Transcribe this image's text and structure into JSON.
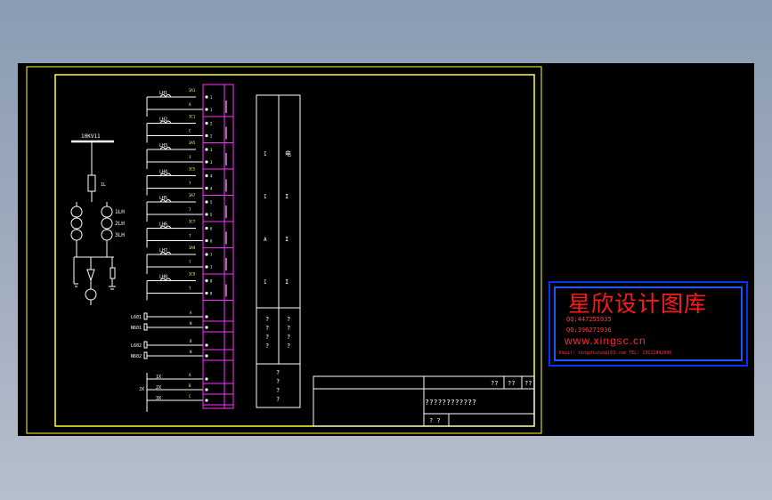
{
  "colors": {
    "frame": "#ffff33",
    "line": "#ffffff",
    "terminal": "#ff33ff",
    "wire_label": "#ffff66",
    "brand_red": "#ff1a1a",
    "brand_blue": "#0033ff"
  },
  "busbar_label": "10KV11",
  "transformer_label": "1L",
  "ct_labels": [
    "1LH",
    "2LH",
    "3LH"
  ],
  "relays": [
    {
      "name": "LH1",
      "wires": [
        "3A1",
        "A"
      ]
    },
    {
      "name": "LH2",
      "wires": [
        "3C1",
        "C"
      ]
    },
    {
      "name": "LH3",
      "wires": [
        "3A5",
        "3"
      ]
    },
    {
      "name": "LH4",
      "wires": [
        "3C5",
        "7"
      ]
    },
    {
      "name": "LH5",
      "wires": [
        "3A7",
        "7"
      ]
    },
    {
      "name": "LH6",
      "wires": [
        "3C7",
        "7"
      ]
    },
    {
      "name": "LH7",
      "wires": [
        "3A9",
        "7"
      ]
    },
    {
      "name": "LH8",
      "wires": [
        "3C9",
        "7"
      ]
    }
  ],
  "signals": [
    {
      "name": "L601",
      "wire": "A"
    },
    {
      "name": "N601",
      "wire": "N"
    },
    {
      "name": "L602",
      "wire": "B"
    },
    {
      "name": "N602",
      "wire": "N"
    }
  ],
  "bottom_group": {
    "prefix": "JX",
    "rows": [
      {
        "name": "1X",
        "wire": "A"
      },
      {
        "name": "2X",
        "wire": "B"
      },
      {
        "name": "3X",
        "wire": "C"
      }
    ]
  },
  "legend_table": {
    "col1": [
      "I",
      "I",
      "A",
      "I"
    ],
    "col2": [
      "电",
      "I",
      "I",
      "I"
    ],
    "notes_col1": [
      "?",
      "?",
      "?",
      "?"
    ],
    "notes_col2": [
      "?",
      "?",
      "?",
      "?"
    ],
    "notes_bottom": [
      "?",
      "?",
      "?",
      "?"
    ]
  },
  "title_block": {
    "cell_a": "??",
    "cell_b": "??",
    "cell_c": "??",
    "drawing_name": "????????????",
    "bottom_cell": "? ?"
  },
  "brand": {
    "title": "星欣设计图库",
    "qq1": "QQ:447255935",
    "qq2": "QQ:396271936",
    "url": "www.xingsc.cn",
    "contact": "Email: xingshuzuo@163.com  TEL: 13111842806"
  }
}
